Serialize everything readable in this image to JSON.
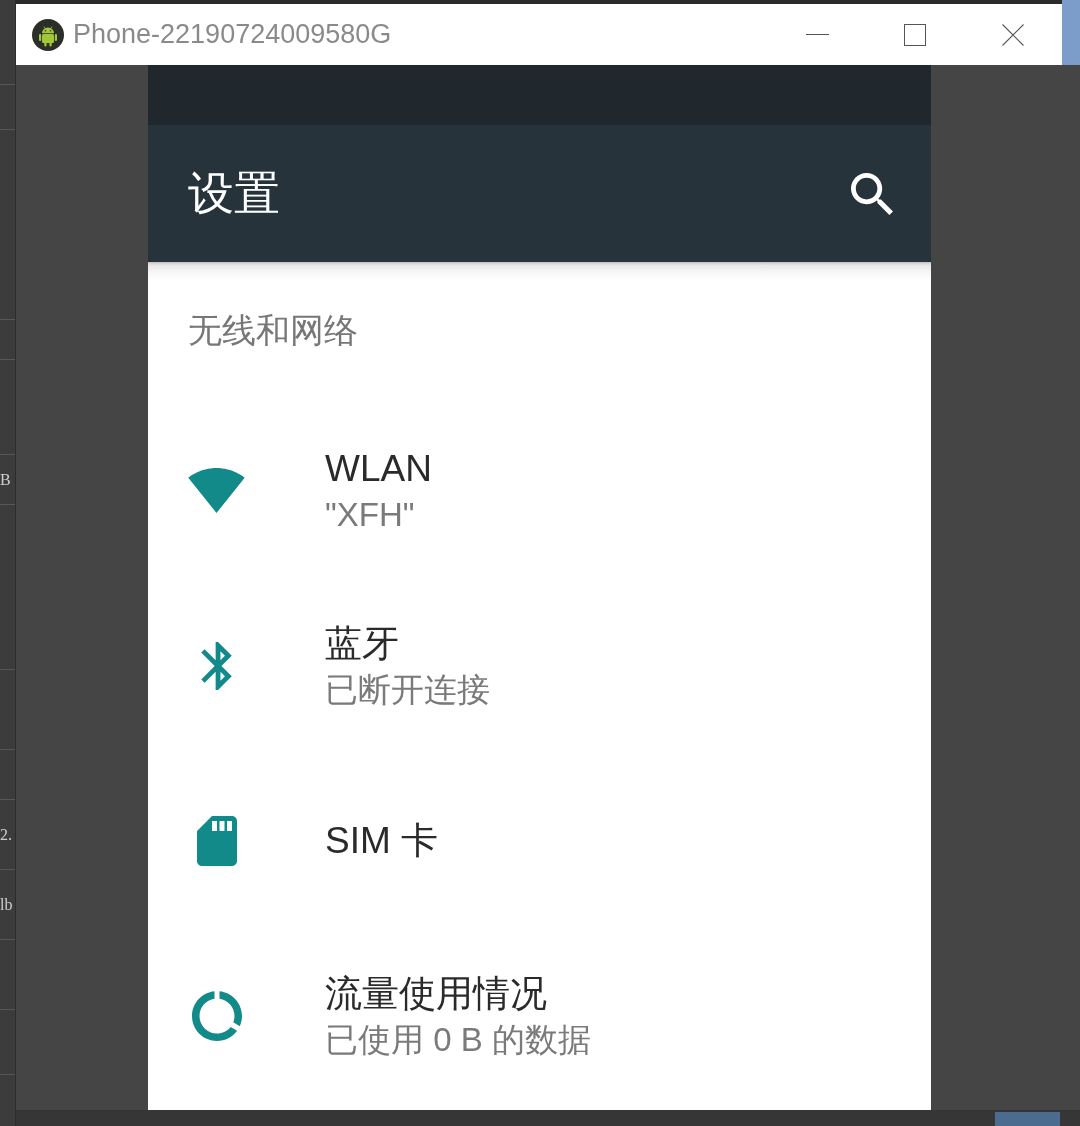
{
  "window": {
    "title": "Phone-22190724009580G"
  },
  "background_window": {
    "cut_texts": [
      "B",
      "2.",
      "lb"
    ]
  },
  "screen": {
    "app_bar": {
      "title": "设置"
    },
    "section": {
      "header": "无线和网络",
      "items": [
        {
          "kind": "wifi",
          "title": "WLAN",
          "summary": "\"XFH\""
        },
        {
          "kind": "bluetooth",
          "title": "蓝牙",
          "summary": "已断开连接"
        },
        {
          "kind": "sim",
          "title": "SIM 卡"
        },
        {
          "kind": "data_usage",
          "title": "流量使用情况",
          "summary": "已使用 0 B 的数据"
        }
      ]
    }
  }
}
